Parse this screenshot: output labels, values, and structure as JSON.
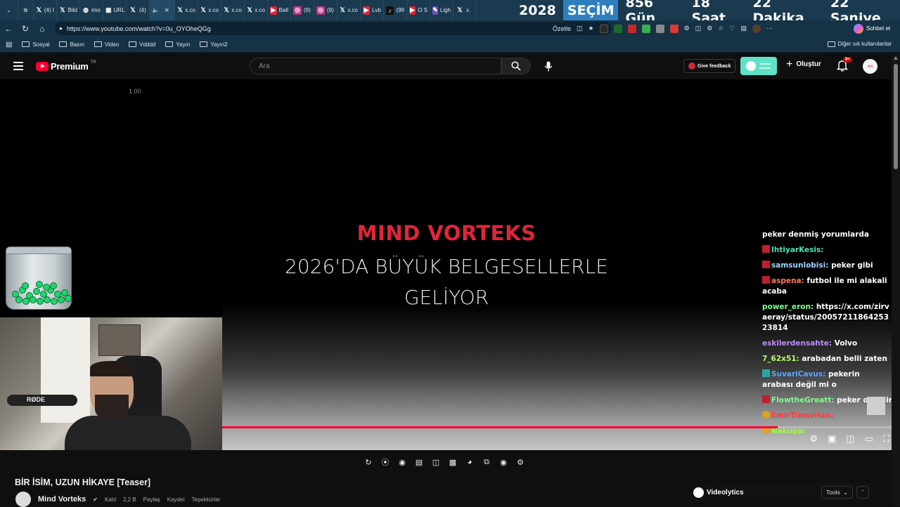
{
  "browser": {
    "tabs": [
      {
        "icon": "x-logo-icon",
        "label": "(4) I"
      },
      {
        "icon": "x-logo-icon",
        "label": "Bild"
      },
      {
        "icon": "globe-icon",
        "label": "imo"
      },
      {
        "icon": "page-icon",
        "label": "URL"
      },
      {
        "icon": "x-logo-icon",
        "label": "(4)"
      },
      {
        "icon": "speaker-icon",
        "label": ""
      },
      {
        "icon": "x-logo-icon",
        "label": "x.co"
      },
      {
        "icon": "x-logo-icon",
        "label": "x.co"
      },
      {
        "icon": "x-logo-icon",
        "label": "x.co"
      },
      {
        "icon": "x-logo-icon",
        "label": "x.co"
      },
      {
        "icon": "youtube-icon",
        "label": "Ball"
      },
      {
        "icon": "instagram-icon",
        "label": "(9)"
      },
      {
        "icon": "instagram-icon",
        "label": "(9)"
      },
      {
        "icon": "x-logo-icon",
        "label": "x.co"
      },
      {
        "icon": "youtube-icon",
        "label": "Lvb"
      },
      {
        "icon": "tiktok-icon",
        "label": "(99"
      },
      {
        "icon": "youtube-icon",
        "label": "O S"
      },
      {
        "icon": "pen-icon",
        "label": "Ligh"
      },
      {
        "icon": "x-logo-icon",
        "label": "x."
      }
    ],
    "countdown": {
      "year": "2028",
      "title": "SEÇİM",
      "days": "856 Gün",
      "hours": "18 Saat",
      "minutes": "22 Dakika",
      "seconds": "22 Saniye"
    },
    "url": "https://www.youtube.com/watch?v=0u_OYOheQGg",
    "summarize_label": "Özetle",
    "chat_label": "Sohbet et",
    "bookmarks": [
      "Sosyal",
      "Basın",
      "Video",
      "Vdddd",
      "Yayın",
      "Yayın2"
    ],
    "other_bookmarks": "Diğer sık kullanılanlar"
  },
  "youtube": {
    "logo_text": "Premium",
    "country": "TR",
    "search_placeholder": "Ara",
    "feedback_label": "Give feedback",
    "create_label": "Oluştur",
    "notification_count": "9+",
    "avatar_text": "akit"
  },
  "player": {
    "speed_readout": "1.00",
    "title": "MIND VORTEKS",
    "subtitle_line1": "2026'DA BÜYÜK BELGESELLERLE",
    "subtitle_line2": "GELİYOR",
    "progress": 0.83,
    "mic_brand": "RØDE",
    "chat": [
      {
        "user": "",
        "color": "#ffffff",
        "text": "peker denmiş yorumlarda",
        "badge": ""
      },
      {
        "user": "IhtiyarKesis:",
        "color": "#4ee0b5",
        "text": "",
        "badge": "red"
      },
      {
        "user": "samsunlobisi:",
        "color": "#9fd4ff",
        "text": "peker gibi",
        "badge": "red"
      },
      {
        "user": "aspena:",
        "color": "#ff7a59",
        "text": "futbol ile mi alakali acaba",
        "badge": "red"
      },
      {
        "user": "power_eron:",
        "color": "#7dff8a",
        "text": "https://x.com/zirvaeray/status/2005721186425323814",
        "badge": ""
      },
      {
        "user": "eskilerdensahte:",
        "color": "#c08cff",
        "text": "Volvo",
        "badge": ""
      },
      {
        "user": "7_62x51:",
        "color": "#b5ff6b",
        "text": "arabadan belli zaten",
        "badge": ""
      },
      {
        "user": "SuvariCavus:",
        "color": "#5aa7ff",
        "text": "pekerin arabası değil mi o",
        "badge": "teal"
      },
      {
        "user": "FlowtheGreatt:",
        "color": "#7dff8a",
        "text": "peker olabilir",
        "badge": "red"
      },
      {
        "user": "EmirTimurHan:",
        "color": "#ff3b3b",
        "text": "",
        "badge": "gold"
      },
      {
        "user": "Nakupa:",
        "color": "#9dff3a",
        "text": "",
        "badge": "gold"
      }
    ]
  },
  "video": {
    "heading": "BİR İSİM, UZUN HİKAYE [Teaser]",
    "channel": "Mind Vorteks",
    "join_label": "Katıl",
    "like_count": "2,2 B",
    "share_label": "Paylaş",
    "save_label": "Kaydet",
    "thanks_label": "Teşekkürler"
  },
  "videolytics": {
    "name": "Videolytics",
    "tools_label": "Tools"
  }
}
